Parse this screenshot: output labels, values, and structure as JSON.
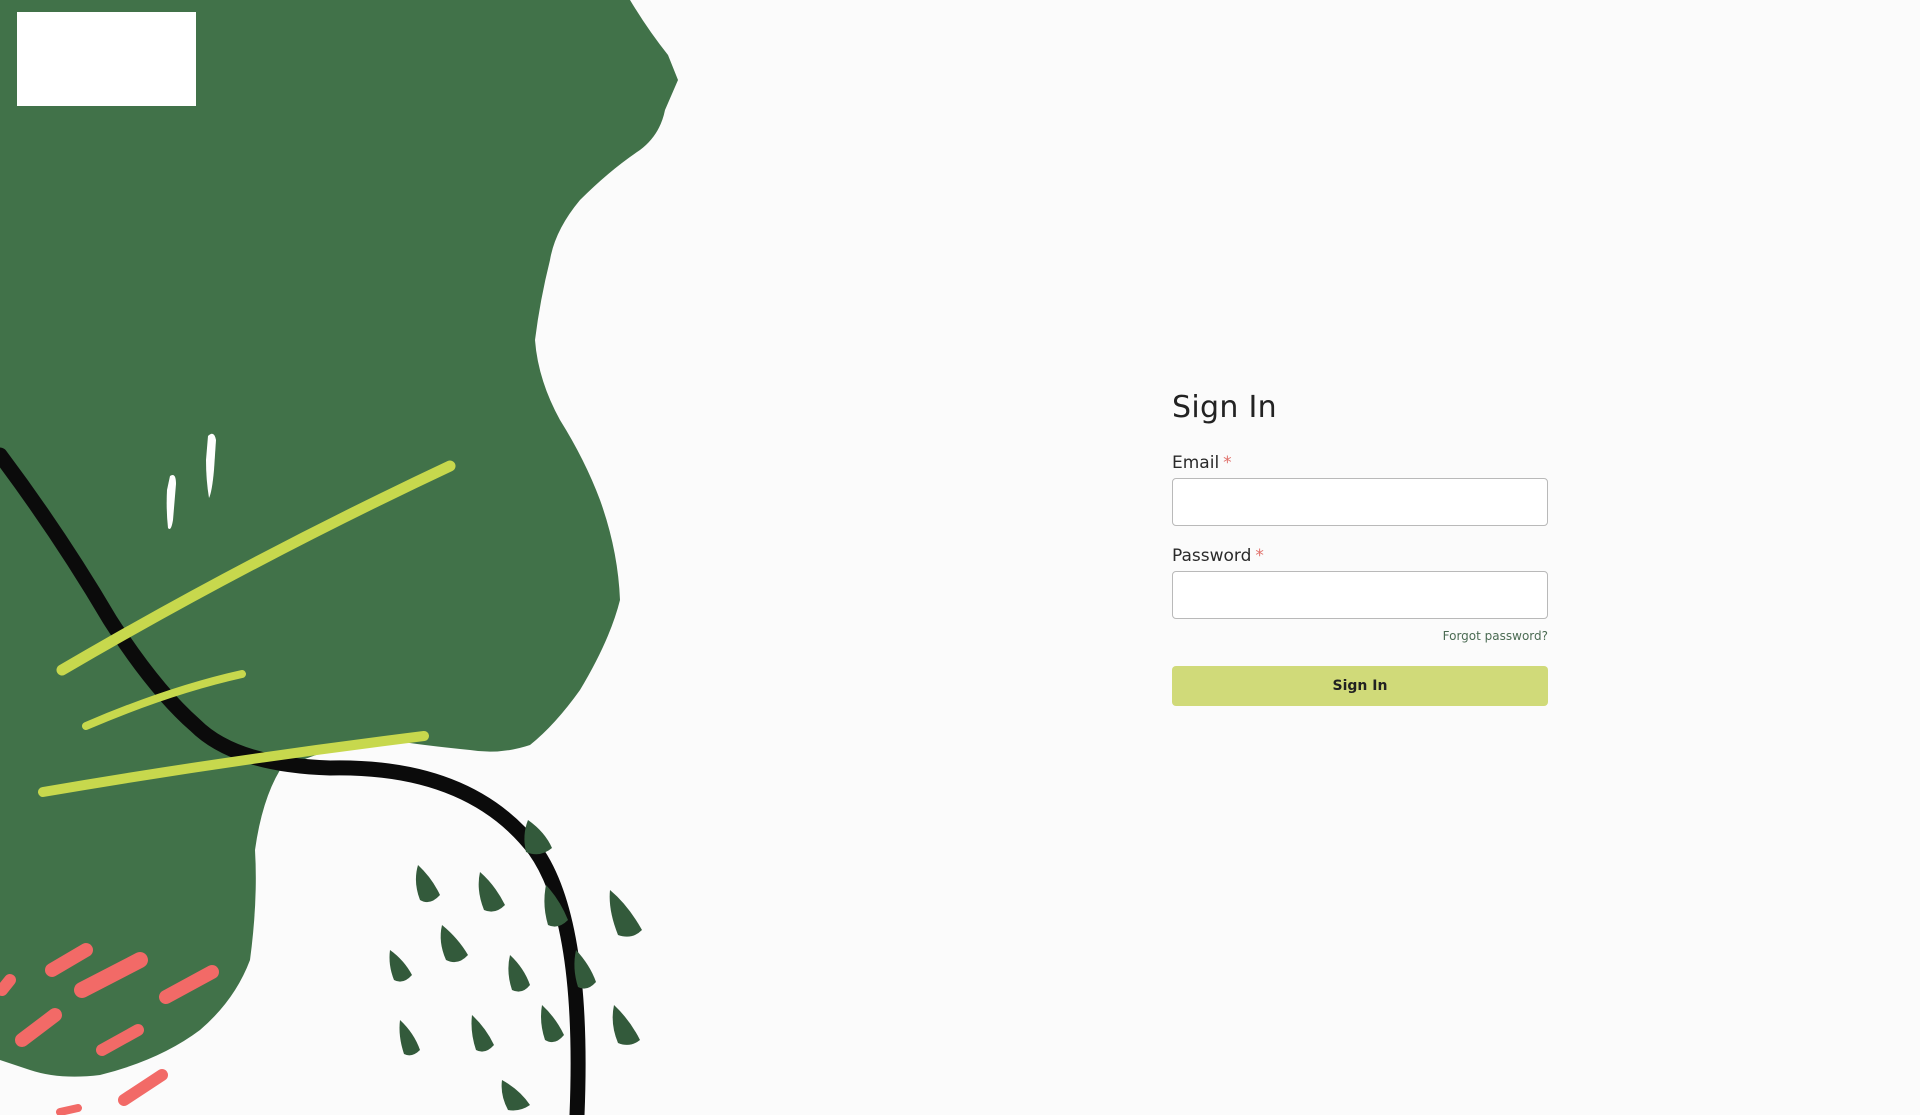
{
  "brand": {
    "primary_green": "#417249",
    "dark_green": "#335a3b",
    "lime": "#c7d84d",
    "coral": "#f26a67",
    "button_bg": "#d0da79"
  },
  "login": {
    "title": "Sign In",
    "email_label": "Email",
    "password_label": "Password",
    "required_marker": "*",
    "email_value": "",
    "password_value": "",
    "forgot_password": "Forgot password?",
    "submit_label": "Sign In"
  }
}
